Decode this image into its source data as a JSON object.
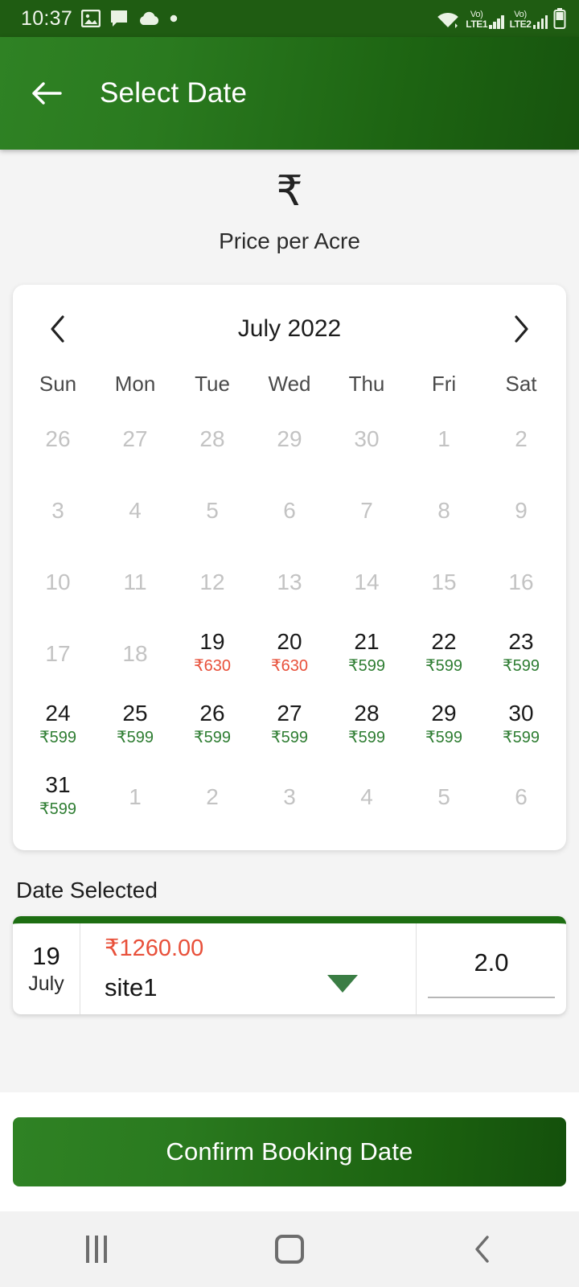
{
  "statusbar": {
    "time": "10:37",
    "left_icons": [
      "photo-icon",
      "message-icon",
      "cloud-icon",
      "dot-icon"
    ],
    "wifi": "wifi-icon",
    "sim1": {
      "volte": "Vo)",
      "network": "LTE1"
    },
    "sim2": {
      "volte": "Vo)",
      "network": "LTE2"
    },
    "battery": "battery-icon"
  },
  "appbar": {
    "back": "back-arrow-icon",
    "title": "Select Date"
  },
  "price_header": {
    "symbol": "₹",
    "label": "Price per Acre"
  },
  "calendar": {
    "prev_label": "‹",
    "next_label": "›",
    "month_title": "July 2022",
    "weekdays": [
      "Sun",
      "Mon",
      "Tue",
      "Wed",
      "Thu",
      "Fri",
      "Sat"
    ],
    "cells": [
      {
        "day": "26",
        "price": "",
        "state": "off"
      },
      {
        "day": "27",
        "price": "",
        "state": "off"
      },
      {
        "day": "28",
        "price": "",
        "state": "off"
      },
      {
        "day": "29",
        "price": "",
        "state": "off"
      },
      {
        "day": "30",
        "price": "",
        "state": "off"
      },
      {
        "day": "1",
        "price": "",
        "state": "off"
      },
      {
        "day": "2",
        "price": "",
        "state": "off"
      },
      {
        "day": "3",
        "price": "",
        "state": "off"
      },
      {
        "day": "4",
        "price": "",
        "state": "off"
      },
      {
        "day": "5",
        "price": "",
        "state": "off"
      },
      {
        "day": "6",
        "price": "",
        "state": "off"
      },
      {
        "day": "7",
        "price": "",
        "state": "off"
      },
      {
        "day": "8",
        "price": "",
        "state": "off"
      },
      {
        "day": "9",
        "price": "",
        "state": "off"
      },
      {
        "day": "10",
        "price": "",
        "state": "off"
      },
      {
        "day": "11",
        "price": "",
        "state": "off"
      },
      {
        "day": "12",
        "price": "",
        "state": "off"
      },
      {
        "day": "13",
        "price": "",
        "state": "off"
      },
      {
        "day": "14",
        "price": "",
        "state": "off"
      },
      {
        "day": "15",
        "price": "",
        "state": "off"
      },
      {
        "day": "16",
        "price": "",
        "state": "off"
      },
      {
        "day": "17",
        "price": "",
        "state": "off"
      },
      {
        "day": "18",
        "price": "",
        "state": "off"
      },
      {
        "day": "19",
        "price": "₹630",
        "state": "on",
        "price_color": "red"
      },
      {
        "day": "20",
        "price": "₹630",
        "state": "on",
        "price_color": "red"
      },
      {
        "day": "21",
        "price": "₹599",
        "state": "on",
        "price_color": "green"
      },
      {
        "day": "22",
        "price": "₹599",
        "state": "on",
        "price_color": "green"
      },
      {
        "day": "23",
        "price": "₹599",
        "state": "on",
        "price_color": "green"
      },
      {
        "day": "24",
        "price": "₹599",
        "state": "on",
        "price_color": "green"
      },
      {
        "day": "25",
        "price": "₹599",
        "state": "on",
        "price_color": "green"
      },
      {
        "day": "26",
        "price": "₹599",
        "state": "on",
        "price_color": "green"
      },
      {
        "day": "27",
        "price": "₹599",
        "state": "on",
        "price_color": "green"
      },
      {
        "day": "28",
        "price": "₹599",
        "state": "on",
        "price_color": "green"
      },
      {
        "day": "29",
        "price": "₹599",
        "state": "on",
        "price_color": "green"
      },
      {
        "day": "30",
        "price": "₹599",
        "state": "on",
        "price_color": "green"
      },
      {
        "day": "31",
        "price": "₹599",
        "state": "on",
        "price_color": "green"
      },
      {
        "day": "1",
        "price": "",
        "state": "off"
      },
      {
        "day": "2",
        "price": "",
        "state": "off"
      },
      {
        "day": "3",
        "price": "",
        "state": "off"
      },
      {
        "day": "4",
        "price": "",
        "state": "off"
      },
      {
        "day": "5",
        "price": "",
        "state": "off"
      },
      {
        "day": "6",
        "price": "",
        "state": "off"
      }
    ]
  },
  "selected": {
    "section_title": "Date Selected",
    "day": "19",
    "month": "July",
    "amount": "₹1260.00",
    "site": "site1",
    "dropdown_icon": "chevron-down-icon",
    "quantity": "2.0"
  },
  "footer": {
    "confirm_label": "Confirm Booking Date"
  },
  "navbar": {
    "recents": "recents-icon",
    "home": "home-icon",
    "back": "back-icon"
  },
  "colors": {
    "brand_green": "#1d6e12",
    "price_green": "#2e7d32",
    "price_red": "#e8503a",
    "bg": "#f4f4f4"
  }
}
